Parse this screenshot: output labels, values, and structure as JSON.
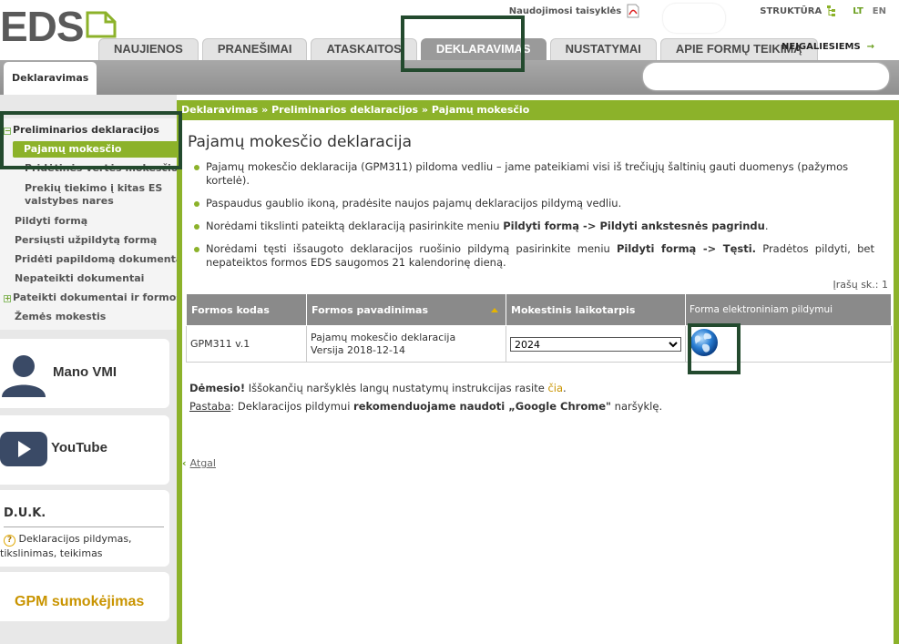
{
  "header": {
    "logo_text": "EDS",
    "top_links": {
      "rules": "Naudojimosi taisyklės",
      "structure": "STRUKTŪRA",
      "lang_lt": "LT",
      "lang_en": "EN"
    },
    "tabs": [
      {
        "label": "NAUJIENOS"
      },
      {
        "label": "PRANEŠIMAI"
      },
      {
        "label": "ATASKAITOS"
      },
      {
        "label": "DEKLARAVIMAS",
        "active": true
      },
      {
        "label": "NUSTATYMAI"
      },
      {
        "label": "APIE FORMŲ TEIKIMĄ"
      }
    ],
    "accessibility": "NEĮGALIESIEMS",
    "subtab": "Deklaravimas"
  },
  "sidebar": {
    "items": [
      {
        "label": "Preliminarios deklaracijos"
      },
      {
        "label": "Pajamų mokesčio",
        "active": true
      },
      {
        "label": "Pridėtinės vertės mokesčio"
      },
      {
        "label": "Prekių tiekimo į kitas ES"
      },
      {
        "label": "valstybes nares"
      },
      {
        "label": "Pildyti formą"
      },
      {
        "label": "Persiųsti užpildytą formą"
      },
      {
        "label": "Pridėti papildomą dokumentą"
      },
      {
        "label": "Nepateikti dokumentai"
      },
      {
        "label": "Pateikti dokumentai ir formos"
      },
      {
        "label": "Žemės mokestis"
      }
    ],
    "cards": {
      "mano_vmi": "Mano VMI",
      "youtube": "YouTube",
      "duk_title": "D.U.K.",
      "duk_text": "Deklaracijos pildymas, tikslinimas, teikimas",
      "gpm": "GPM sumokėjimas"
    }
  },
  "breadcrumb": {
    "part1": "Deklaravimas »",
    "part2": "Preliminarios deklaracijos",
    "part3": "» Pajamų mokesčio"
  },
  "page": {
    "title": "Pajamų mokesčio deklaracija",
    "bullets": {
      "b1": "Pajamų mokesčio deklaracija (GPM311) pildoma vedliu – jame pateikiami visi iš trečiųjų šaltinių gauti duomenys (pažymos kortelė).",
      "b2": "Paspaudus gaublio ikoną, pradėsite naujos pajamų deklaracijos pildymą vedliu.",
      "b3_pre": "Norėdami tikslinti pateiktą deklaraciją pasirinkite meniu ",
      "b3_bold": "Pildyti formą -> Pildyti ankstesnės pagrindu",
      "b3_post": ".",
      "b4_pre": "Norėdami tęsti išsaugoto deklaracijos ruošinio pildymą pasirinkite meniu ",
      "b4_bold": "Pildyti formą -> Tęsti.",
      "b4_post": " Pradėtos pildyti, bet nepateiktos formos EDS saugomos 21 kalendorinę dieną."
    },
    "record_count": "Įrašų sk.: 1"
  },
  "table": {
    "headers": {
      "code": "Formos kodas",
      "name": "Formos pavadinimas",
      "period": "Mokestinis laikotarpis",
      "form": "Forma elektroniniam pildymui"
    },
    "row": {
      "code": "GPM311 v.1",
      "name_line1": "Pajamų mokesčio deklaracija",
      "name_line2": "Versija 2018-12-14",
      "period_selected": "2024",
      "form_icon": "globe-icon"
    }
  },
  "notices": {
    "attention_label": "Dėmesio!",
    "attention_text": " Iššokančių naršyklės langų nustatymų instrukcijas rasite ",
    "attention_link": "čia",
    "attention_end": ".",
    "note_label": "Pastaba",
    "note_text": ": Deklaracijos pildymui ",
    "note_bold": "rekomenduojame naudoti „Google Chrome\"",
    "note_end": " naršyklę."
  },
  "back_link": "Atgal",
  "colors": {
    "accent_green": "#8cb22a",
    "header_gray": "#9a9a9a",
    "highlight_box": "#234a2e",
    "link_gold": "#c99400"
  }
}
